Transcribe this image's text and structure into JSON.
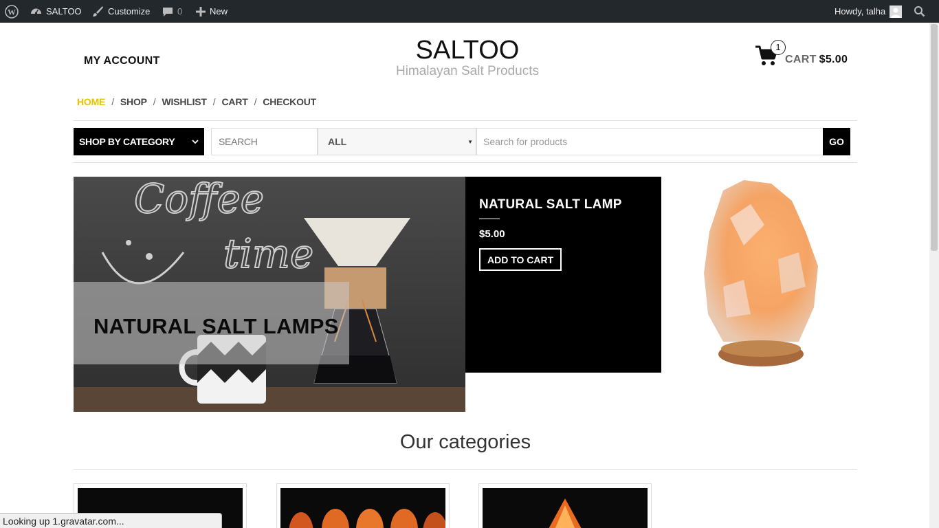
{
  "admin_bar": {
    "site_name": "SALTOO",
    "customize": "Customize",
    "comments_count": "0",
    "new": "New",
    "howdy": "Howdy, talha",
    "icons": [
      "wordpress-icon",
      "dashboard-icon",
      "brush-icon",
      "comment-icon",
      "plus-icon",
      "avatar",
      "search-icon"
    ]
  },
  "header": {
    "my_account": "MY ACCOUNT",
    "site_title": "SALTOO",
    "tagline": "Himalayan Salt Products",
    "cart_count": "1",
    "cart_label": "CART",
    "cart_amount": "$5.00"
  },
  "nav": {
    "items": [
      "HOME",
      "SHOP",
      "WISHLIST",
      "CART",
      "CHECKOUT"
    ],
    "separator": "/",
    "active": "HOME",
    "active_color": "#e8c200"
  },
  "search": {
    "shop_by_category": "SHOP BY CATEGORY",
    "search_label": "SEARCH",
    "category_selected": "ALL",
    "placeholder": "Search for products",
    "go": "GO"
  },
  "hero": {
    "title": "NATURAL SALT LAMPS",
    "chalk_text_1": "Coffee",
    "chalk_text_2": "time"
  },
  "promo": {
    "product": "NATURAL SALT LAMP",
    "price": "$5.00",
    "button": "ADD TO CART"
  },
  "categories": {
    "heading": "Our categories"
  },
  "status_bar": {
    "text": "Looking up 1.gravatar.com..."
  }
}
